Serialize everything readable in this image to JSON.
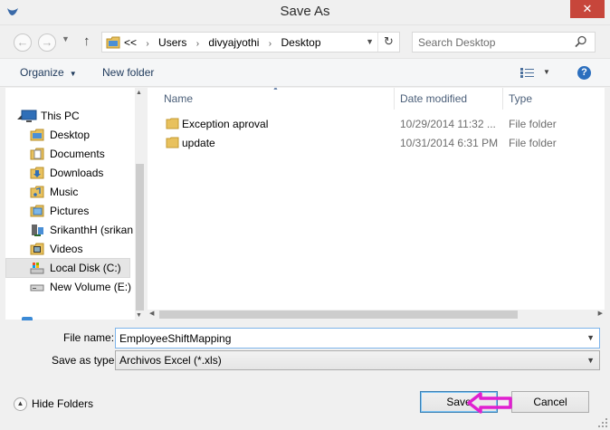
{
  "window": {
    "title": "Save As",
    "close_glyph": "✕"
  },
  "nav": {
    "back_icon": "←",
    "forward_icon": "→",
    "up_icon": "↑",
    "breadcrumb": {
      "overflow": "<<",
      "items": [
        "Users",
        "divyajyothi",
        "Desktop"
      ],
      "separator": "›"
    },
    "refresh_icon": "↻",
    "search_placeholder": "Search Desktop"
  },
  "toolbar": {
    "organize": "Organize",
    "new_folder": "New folder",
    "help": "?"
  },
  "sidebar": {
    "items": [
      {
        "label": "This PC",
        "icon": "computer-icon"
      },
      {
        "label": "Desktop",
        "icon": "desktop-folder-icon"
      },
      {
        "label": "Documents",
        "icon": "documents-icon"
      },
      {
        "label": "Downloads",
        "icon": "downloads-icon"
      },
      {
        "label": "Music",
        "icon": "music-icon"
      },
      {
        "label": "Pictures",
        "icon": "pictures-icon"
      },
      {
        "label": "SrikanthH (srikan",
        "icon": "network-user-icon"
      },
      {
        "label": "Videos",
        "icon": "videos-icon"
      },
      {
        "label": "Local Disk (C:)",
        "icon": "drive-icon",
        "selected": true
      },
      {
        "label": "New Volume (E:)",
        "icon": "drive-icon"
      }
    ]
  },
  "files": {
    "columns": {
      "name": "Name",
      "date": "Date modified",
      "type": "Type"
    },
    "rows": [
      {
        "name": "Exception aproval",
        "date": "10/29/2014 11:32 ...",
        "type": "File folder",
        "icon": "folder-icon"
      },
      {
        "name": "update",
        "date": "10/31/2014 6:31 PM",
        "type": "File folder",
        "icon": "folder-icon"
      }
    ]
  },
  "form": {
    "file_name_label": "File name:",
    "file_name_value": "EmployeeShiftMapping",
    "save_type_label": "Save as type:",
    "save_type_value": "Archivos Excel (*.xls)"
  },
  "footer": {
    "hide_folders": "Hide Folders",
    "save": "Save",
    "cancel": "Cancel"
  },
  "colors": {
    "accent": "#2c6fbe",
    "close": "#c7463b",
    "annotation": "#e020d0",
    "folder": "#e8c15d"
  }
}
